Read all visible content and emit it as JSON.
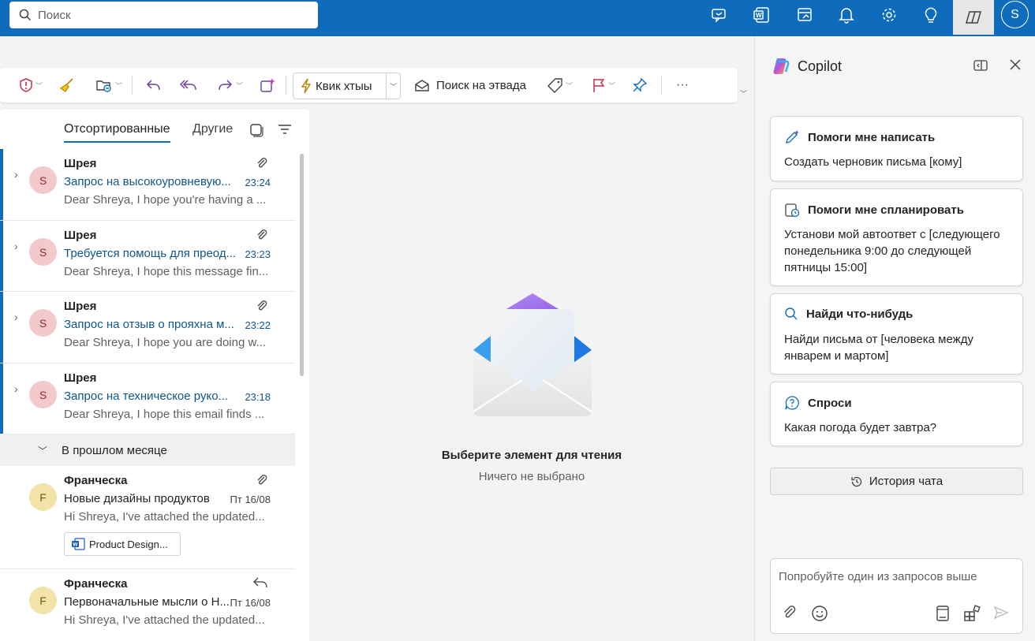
{
  "topbar": {
    "search_placeholder": "Поиск",
    "avatar_letter": "S",
    "icons": [
      "meet-now-icon",
      "word-icon",
      "my-day-icon",
      "bell-icon",
      "gear-icon",
      "lightbulb-icon",
      "copilot-icon"
    ]
  },
  "ribbon": {
    "quick_steps_label": "Квик хтыы",
    "find_time_label": "Поиск на этвада",
    "more_label": "···"
  },
  "maillist": {
    "tabs": {
      "focused": "Отсортированные",
      "other": "Другие"
    },
    "messages": [
      {
        "avatar": "S",
        "sender": "Шрея",
        "subject": "Запрос на высокоуровневую...",
        "time": "23:24",
        "preview": "Dear Shreya, I hope you're having a ..."
      },
      {
        "avatar": "S",
        "sender": "Шрея",
        "subject": "Требуется помощь для преод...",
        "time": "23:23",
        "preview": "Dear Shreya, I hope this message fin..."
      },
      {
        "avatar": "S",
        "sender": "Шрея",
        "subject": "Запрос на отзыв о прояхна м...",
        "time": "23:22",
        "preview": "Dear Shreya, I hope you are doing w..."
      },
      {
        "avatar": "S",
        "sender": "Шрея",
        "subject": "Запрос на техническое руко...",
        "time": "23:18",
        "preview": "Dear Shreya, I hope this email finds ..."
      }
    ],
    "section_label": "В прошлом месяце",
    "older": [
      {
        "avatar": "F",
        "sender": "Франческа",
        "subject": "Новые дизайны продуктов",
        "time": "Пт 16/08",
        "preview": "Hi Shreya, I've attached the updated...",
        "attachment": "Product Design..."
      },
      {
        "avatar": "F",
        "sender": "Франческа",
        "subject": "Первоначальные мысли о Н...",
        "time": "Пт 16/08",
        "preview": "Hi Shreya, I've attached the updated..."
      }
    ]
  },
  "reading": {
    "title": "Выберите элемент для чтения",
    "subtitle": "Ничего не выбрано"
  },
  "copilot": {
    "title": "Copilot",
    "cards": [
      {
        "title": "Помоги мне написать",
        "body": "Создать черновик письма [кому]"
      },
      {
        "title": "Помоги мне спланировать",
        "body": "Установи мой автоответ с [следующего понедельника 9:00 до следующей пятницы 15:00]"
      },
      {
        "title": "Найди что-нибудь",
        "body": "Найди письма от [человека между январем и мартом]"
      },
      {
        "title": "Спроси",
        "body": "Какая погода будет завтра?"
      }
    ],
    "history_label": "История чата",
    "input_placeholder": "Попробуйте один из запросов выше"
  },
  "colors": {
    "accent": "#0f6cbd",
    "unread_bar": "#0f6cbd",
    "link_subject": "#0f548c"
  }
}
